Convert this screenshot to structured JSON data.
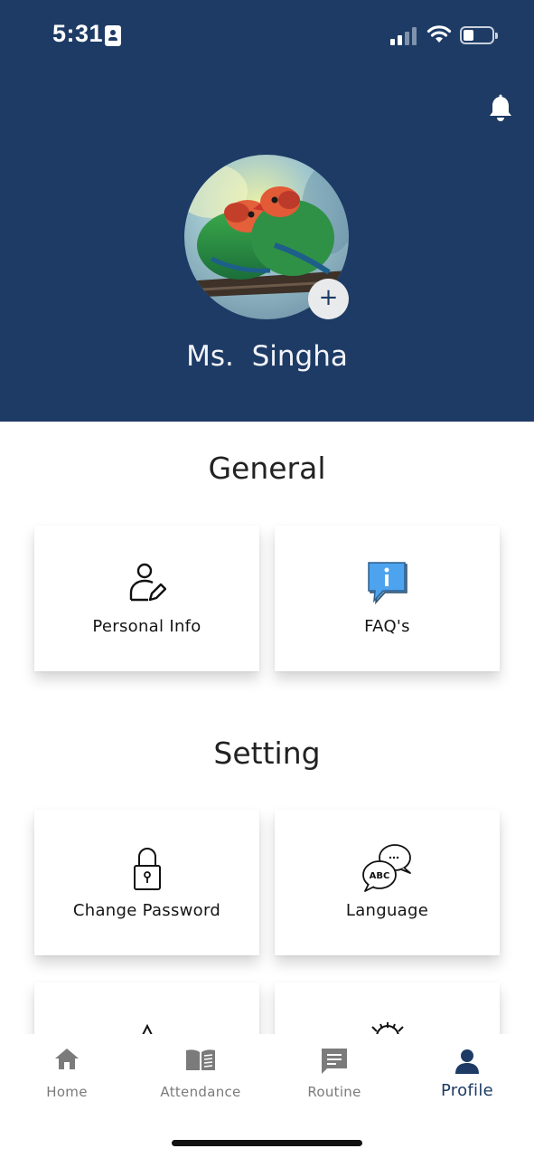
{
  "status_bar": {
    "time": "5:31",
    "battery_level": 0.35,
    "signal_bars_filled": 2,
    "signal_bars_total": 4
  },
  "header": {
    "background_color": "#1d3b65",
    "profile_name": "Ms.  Singha",
    "add_photo_label": "+",
    "icons": {
      "notification": "bell-icon",
      "avatar": "avatar-image"
    }
  },
  "general": {
    "title": "General",
    "cards": [
      {
        "label": "Personal Info",
        "icon": "user-edit-icon"
      },
      {
        "label": "FAQ's",
        "icon": "info-bubble-icon"
      }
    ]
  },
  "setting": {
    "title": "Setting",
    "cards": [
      {
        "label": "Change Password",
        "icon": "lock-icon"
      },
      {
        "label": "Language",
        "icon": "language-chat-icon"
      }
    ]
  },
  "bottom_nav": {
    "items": [
      {
        "label": "Home",
        "icon": "home-icon"
      },
      {
        "label": "Attendance",
        "icon": "book-icon"
      },
      {
        "label": "Routine",
        "icon": "message-icon"
      },
      {
        "label": "Profile",
        "icon": "person-icon",
        "active": true
      }
    ],
    "active_color": "#1d3b65",
    "inactive_color": "#7b7b7b"
  }
}
